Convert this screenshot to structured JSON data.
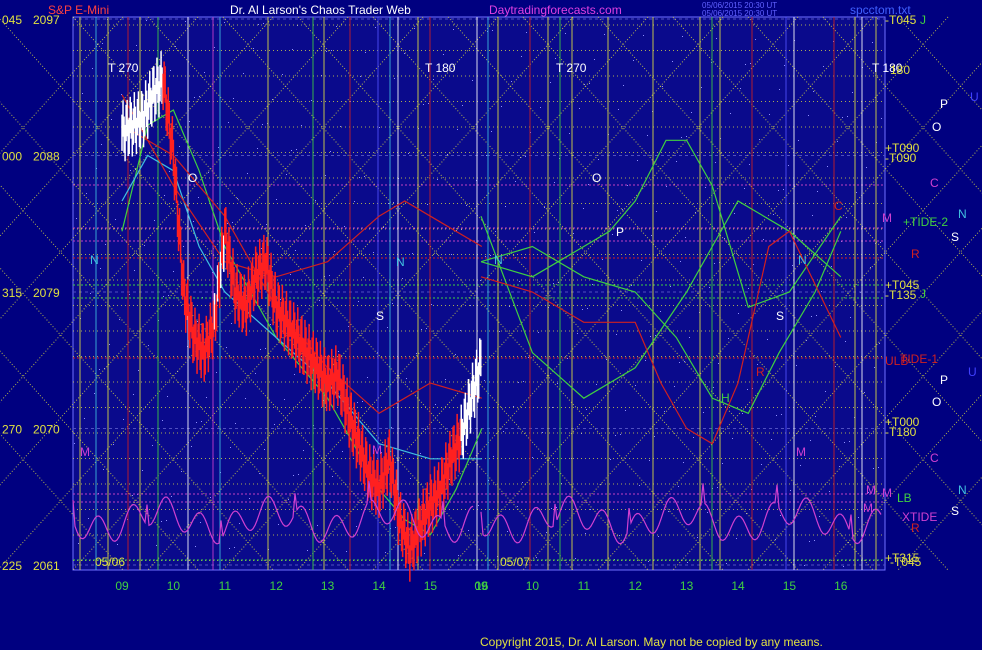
{
  "header": {
    "instrument": "S&P E-Mini",
    "title": "Dr. Al Larson's Chaos Trader Web",
    "site": "Daytradingforecasts.com",
    "stamp1": "05/06/2015 20:30 UT",
    "stamp2": "05/06/2015 20:30 UT",
    "file": "spcctom.txt"
  },
  "footer": {
    "copyright": "Copyright 2015, Dr. Al Larson. May not be copied by any means."
  },
  "colors": {
    "background": "#000080",
    "plot_bg": "#0a0a8c",
    "price_up": "#ffffff",
    "price_down": "#ff2020",
    "green": "#40d040",
    "red": "#d02020",
    "cyan": "#40c0e0",
    "magenta": "#d040d0",
    "yellow": "#e0e040",
    "grid": "#5050c0"
  },
  "chart_data": {
    "type": "line",
    "title": "S&P E-Mini",
    "y_axis": {
      "price_ticks": [
        "2097",
        "2088",
        "2079",
        "2070",
        "2061"
      ],
      "angle_ticks": [
        "045",
        "000",
        "315",
        "270",
        "225"
      ],
      "ylim": [
        2061,
        2097
      ]
    },
    "x_axis": {
      "ticks": [
        "09",
        "10",
        "11",
        "12",
        "13",
        "14",
        "15",
        "16",
        "09",
        "10",
        "11",
        "12",
        "13",
        "14",
        "15",
        "16"
      ],
      "dates": [
        "05/06",
        "05/07"
      ]
    },
    "series": [
      {
        "name": "price",
        "x": [
          9.0,
          9.2,
          9.4,
          9.6,
          9.8,
          10.0,
          10.2,
          10.4,
          10.6,
          10.8,
          11.0,
          11.2,
          11.4,
          11.6,
          11.8,
          12.0,
          12.2,
          12.4,
          12.6,
          12.8,
          13.0,
          13.2,
          13.4,
          13.6,
          13.8,
          14.0,
          14.2,
          14.4,
          14.6,
          14.8,
          15.0,
          15.2,
          15.4,
          15.6,
          15.8,
          16.0
        ],
        "y": [
          2089.5,
          2090.0,
          2090.4,
          2092.0,
          2093.0,
          2088.0,
          2079.0,
          2076.0,
          2075.0,
          2077.0,
          2083.0,
          2079.0,
          2078.0,
          2080.0,
          2081.0,
          2078.0,
          2077.0,
          2076.0,
          2075.0,
          2074.0,
          2073.0,
          2073.5,
          2071.0,
          2069.0,
          2067.0,
          2066.0,
          2068.0,
          2064.0,
          2062.0,
          2063.5,
          2065.0,
          2066.0,
          2068.0,
          2069.5,
          2072.0,
          2074.5
        ]
      },
      {
        "name": "",
        "x": [
          9.0,
          9.5,
          10.0,
          10.5,
          11.0,
          12.0,
          13.0,
          14.0,
          14.5,
          15.0,
          15.5,
          16.0
        ],
        "y": [
          2083,
          2090,
          2091,
          2087,
          2082,
          2076,
          2072,
          2066,
          2064,
          2063,
          2066,
          2070
        ]
      },
      {
        "name": "",
        "x": [
          9.0,
          9.5,
          10.0,
          10.5,
          11.0,
          12.0,
          13.0,
          14.0,
          15.0,
          16.0
        ],
        "y": [
          2085,
          2088,
          2087,
          2082,
          2079,
          2076,
          2073,
          2069,
          2068,
          2068
        ]
      },
      {
        "name": "",
        "x": [
          9.0,
          10.0,
          11.0,
          12.0,
          13.0,
          14.0,
          14.5,
          15.0,
          16.0
        ],
        "y": [
          2092,
          2086,
          2081,
          2080,
          2081,
          2084,
          2085,
          2084,
          2082
        ]
      },
      {
        "name": "",
        "x": [
          9.0,
          10.0,
          11.0,
          12.0,
          13.0,
          14.0,
          15.0,
          16.0
        ],
        "y": [
          2090,
          2088,
          2084,
          2078,
          2074,
          2071,
          2073,
          2072
        ]
      },
      {
        "name": "",
        "x": [
          9.0,
          10.0,
          11.0,
          12.0,
          13.0,
          13.5,
          14.0,
          15.0,
          16.0
        ],
        "y": [
          2084,
          2075,
          2072,
          2074,
          2079,
          2082,
          2085,
          2083,
          2080
        ]
      },
      {
        "name": "",
        "x": [
          9.0,
          10.0,
          11.0,
          12.0,
          12.8,
          13.5,
          14.2,
          14.8,
          15.5,
          16.0
        ],
        "y": [
          2081,
          2082,
          2080,
          2079,
          2076,
          2072,
          2071,
          2075,
          2079,
          2083
        ]
      },
      {
        "name": "",
        "x": [
          9.0,
          10.0,
          10.5,
          11.5,
          12.0,
          12.6,
          13.0,
          13.5,
          14.2,
          15.0,
          16.0
        ],
        "y": [
          2081,
          2080,
          2081,
          2083,
          2085,
          2089,
          2089,
          2086,
          2078,
          2079,
          2084
        ]
      },
      {
        "name": "",
        "x": [
          9.0,
          10.0,
          11.0,
          12.0,
          12.5,
          13.0,
          13.5,
          14.0,
          14.6,
          15.0,
          16.0
        ],
        "y": [
          2080,
          2079,
          2077,
          2077,
          2073,
          2070,
          2069,
          2073,
          2082,
          2083,
          2076
        ]
      }
    ],
    "vertical_markers": [
      "T 270",
      "T 180",
      "T 270",
      "T 180",
      "O",
      "O",
      "N",
      "N",
      "N",
      "N",
      "S",
      "S",
      "P",
      "H",
      "R",
      "C",
      "M",
      "M",
      "M",
      "M",
      "M"
    ],
    "right_labels": [
      {
        "text": "-T045",
        "color": "#e0e040"
      },
      {
        "text": "J",
        "color": "#40d040"
      },
      {
        "text": "180",
        "color": "#e0e040"
      },
      {
        "text": "P",
        "color": "#ffffff"
      },
      {
        "text": "U",
        "color": "#4040ff"
      },
      {
        "text": "O",
        "color": "#ffffff"
      },
      {
        "text": "+T090",
        "color": "#e0e040"
      },
      {
        "text": "-T090",
        "color": "#e0e040"
      },
      {
        "text": "C",
        "color": "#d040d0"
      },
      {
        "text": "M",
        "color": "#d040d0"
      },
      {
        "text": "+TIDE-2",
        "color": "#40d040"
      },
      {
        "text": "N",
        "color": "#40c0e0"
      },
      {
        "text": "S",
        "color": "#ffffff"
      },
      {
        "text": "R",
        "color": "#d02020"
      },
      {
        "text": "+T045",
        "color": "#e0e040"
      },
      {
        "text": "-T135",
        "color": "#e0e040"
      },
      {
        "text": "J",
        "color": "#40d040"
      },
      {
        "text": "ULB",
        "color": "#d02020"
      },
      {
        "text": "TIDE-1",
        "color": "#d02020"
      },
      {
        "text": "U",
        "color": "#4040ff"
      },
      {
        "text": "P",
        "color": "#ffffff"
      },
      {
        "text": "O",
        "color": "#ffffff"
      },
      {
        "text": "+T000",
        "color": "#e0e040"
      },
      {
        "text": "-T180",
        "color": "#e0e040"
      },
      {
        "text": "C",
        "color": "#d040d0"
      },
      {
        "text": "M",
        "color": "#d040d0"
      },
      {
        "text": "LB",
        "color": "#40d040"
      },
      {
        "text": "N",
        "color": "#40c0e0"
      },
      {
        "text": "XTIDE",
        "color": "#d040d0"
      },
      {
        "text": "S",
        "color": "#ffffff"
      },
      {
        "text": "R",
        "color": "#d02020"
      },
      {
        "text": "+T315",
        "color": "#e0e040"
      },
      {
        "text": "-T045",
        "color": "#e0e040"
      }
    ],
    "grid": true
  }
}
